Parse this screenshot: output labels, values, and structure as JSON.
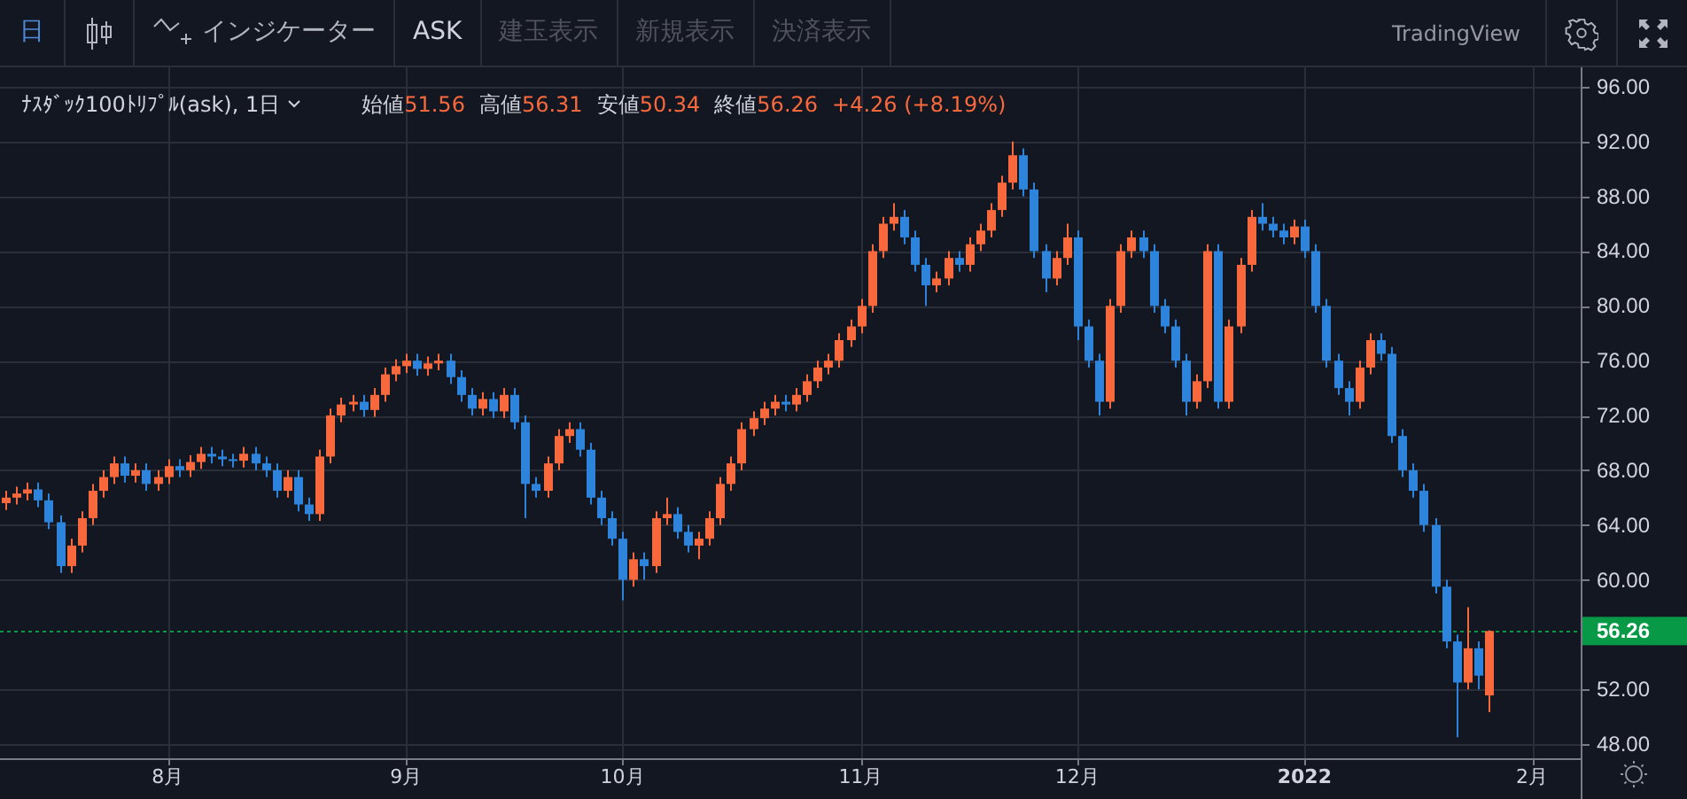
{
  "toolbar": {
    "interval": "日",
    "indicators_label": "インジケーター",
    "items": [
      {
        "label": "ASK",
        "disabled": false
      },
      {
        "label": "建玉表示",
        "disabled": true
      },
      {
        "label": "新規表示",
        "disabled": true
      },
      {
        "label": "決済表示",
        "disabled": true
      }
    ],
    "brand": "TradingView"
  },
  "legend": {
    "symbol": "ﾅｽﾀﾞｯｸ100ﾄﾘﾌﾟﾙ(ask), 1日",
    "values": [
      {
        "label": "始値",
        "value": "51.56"
      },
      {
        "label": "高値",
        "value": "56.31"
      },
      {
        "label": "安値",
        "value": "50.34"
      },
      {
        "label": "終値",
        "value": "56.26"
      }
    ],
    "change": "+4.26 (+8.19%)"
  },
  "chart": {
    "chart_data": {
      "type": "candlestick",
      "grid": true,
      "ylim": [
        46.97,
        97.42
      ],
      "yticks": [
        {
          "value": 48,
          "label": "48.00"
        },
        {
          "value": 52,
          "label": "52.00"
        },
        {
          "value": 60,
          "label": "60.00"
        },
        {
          "value": 64,
          "label": "64.00"
        },
        {
          "value": 68,
          "label": "68.00"
        },
        {
          "value": 72,
          "label": "72.00"
        },
        {
          "value": 76,
          "label": "76.00"
        },
        {
          "value": 80,
          "label": "80.00"
        },
        {
          "value": 84,
          "label": "84.00"
        },
        {
          "value": 88,
          "label": "88.00"
        },
        {
          "value": 92,
          "label": "92.00"
        },
        {
          "value": 96,
          "label": "96.00"
        }
      ],
      "ref_lines": [
        {
          "axis": "y",
          "value": 56.26,
          "label": "56.26",
          "color": "#089947"
        }
      ],
      "categories": [
        null,
        null,
        null,
        null,
        null,
        null,
        null,
        null,
        null,
        null,
        null,
        null,
        null,
        null,
        null,
        "8月",
        null,
        null,
        null,
        null,
        null,
        null,
        null,
        null,
        null,
        null,
        null,
        null,
        null,
        null,
        null,
        null,
        null,
        null,
        null,
        null,
        null,
        "9月",
        null,
        null,
        null,
        null,
        null,
        null,
        null,
        null,
        null,
        null,
        null,
        null,
        null,
        null,
        null,
        null,
        null,
        null,
        null,
        "10月",
        null,
        null,
        null,
        null,
        null,
        null,
        null,
        null,
        null,
        null,
        null,
        null,
        null,
        null,
        null,
        null,
        null,
        null,
        null,
        null,
        null,
        "11月",
        null,
        null,
        null,
        null,
        null,
        null,
        null,
        null,
        null,
        null,
        null,
        null,
        null,
        null,
        null,
        null,
        null,
        null,
        null,
        "12月",
        null,
        null,
        null,
        null,
        null,
        null,
        null,
        null,
        null,
        null,
        null,
        null,
        null,
        null,
        null,
        null,
        null,
        null,
        null,
        null,
        "2022",
        null,
        null,
        null,
        null,
        null,
        null,
        null,
        null,
        null,
        null,
        null,
        null,
        null,
        null,
        null,
        null,
        null,
        null,
        null,
        null,
        "2月"
      ],
      "ohlc": [
        [
          65.6,
          66.5,
          65.1,
          66.0
        ],
        [
          66.0,
          66.8,
          65.5,
          66.3
        ],
        [
          66.3,
          67.1,
          65.8,
          66.6
        ],
        [
          66.6,
          67.1,
          65.3,
          65.8
        ],
        [
          65.8,
          66.3,
          63.7,
          64.2
        ],
        [
          64.2,
          64.7,
          60.5,
          61.0
        ],
        [
          61.0,
          63.0,
          60.5,
          62.5
        ],
        [
          62.5,
          65.0,
          62.0,
          64.5
        ],
        [
          64.5,
          67.0,
          64.0,
          66.5
        ],
        [
          66.5,
          68.0,
          66.0,
          67.5
        ],
        [
          67.5,
          69.0,
          67.0,
          68.5
        ],
        [
          68.5,
          69.0,
          67.1,
          67.6
        ],
        [
          67.6,
          68.5,
          67.1,
          68.0
        ],
        [
          68.0,
          68.5,
          66.5,
          67.0
        ],
        [
          67.0,
          68.0,
          66.5,
          67.5
        ],
        [
          67.5,
          68.8,
          67.0,
          68.3
        ],
        [
          68.3,
          68.8,
          67.5,
          68.0
        ],
        [
          68.0,
          69.1,
          67.5,
          68.6
        ],
        [
          68.6,
          69.7,
          68.1,
          69.2
        ],
        [
          69.2,
          69.7,
          68.5,
          69.0
        ],
        [
          69.0,
          69.5,
          68.3,
          68.8
        ],
        [
          68.8,
          69.2,
          68.2,
          68.7
        ],
        [
          68.7,
          69.7,
          68.2,
          69.2
        ],
        [
          69.2,
          69.7,
          68.0,
          68.5
        ],
        [
          68.5,
          69.0,
          67.5,
          68.0
        ],
        [
          68.0,
          68.5,
          66.0,
          66.5
        ],
        [
          66.5,
          68.0,
          66.0,
          67.5
        ],
        [
          67.5,
          68.0,
          65.0,
          65.5
        ],
        [
          65.5,
          66.0,
          64.3,
          64.8
        ],
        [
          64.8,
          69.5,
          64.3,
          69.0
        ],
        [
          69.0,
          72.5,
          68.5,
          72.0
        ],
        [
          72.0,
          73.3,
          71.5,
          72.8
        ],
        [
          72.8,
          73.5,
          72.3,
          73.0
        ],
        [
          73.0,
          73.5,
          71.9,
          72.4
        ],
        [
          72.4,
          74.0,
          71.9,
          73.5
        ],
        [
          73.5,
          75.5,
          73.0,
          75.0
        ],
        [
          75.0,
          76.1,
          74.5,
          75.6
        ],
        [
          75.6,
          76.5,
          75.1,
          76.0
        ],
        [
          76.0,
          76.5,
          74.9,
          75.4
        ],
        [
          75.4,
          76.3,
          74.9,
          75.8
        ],
        [
          75.8,
          76.5,
          75.3,
          76.0
        ],
        [
          76.0,
          76.5,
          74.3,
          74.8
        ],
        [
          74.8,
          75.3,
          73.0,
          73.5
        ],
        [
          73.5,
          74.0,
          72.0,
          72.5
        ],
        [
          72.5,
          73.7,
          72.0,
          73.2
        ],
        [
          73.2,
          73.7,
          71.8,
          72.3
        ],
        [
          72.3,
          74.0,
          71.8,
          73.5
        ],
        [
          73.5,
          74.0,
          71.0,
          71.5
        ],
        [
          71.5,
          72.0,
          64.5,
          67.0
        ],
        [
          67.0,
          67.5,
          66.0,
          66.5
        ],
        [
          66.5,
          69.0,
          66.0,
          68.5
        ],
        [
          68.5,
          71.0,
          68.0,
          70.5
        ],
        [
          70.5,
          71.5,
          70.0,
          71.0
        ],
        [
          71.0,
          71.5,
          69.0,
          69.5
        ],
        [
          69.5,
          70.0,
          65.5,
          66.0
        ],
        [
          66.0,
          66.5,
          64.0,
          64.5
        ],
        [
          64.5,
          65.0,
          62.5,
          63.0
        ],
        [
          63.0,
          63.5,
          58.5,
          60.0
        ],
        [
          60.0,
          62.0,
          59.5,
          61.5
        ],
        [
          61.5,
          62.0,
          60.0,
          61.0
        ],
        [
          61.0,
          65.0,
          60.5,
          64.5
        ],
        [
          64.5,
          66.0,
          64.0,
          64.8
        ],
        [
          64.8,
          65.3,
          63.0,
          63.5
        ],
        [
          63.5,
          64.0,
          62.0,
          62.5
        ],
        [
          62.5,
          63.5,
          61.5,
          63.0
        ],
        [
          63.0,
          65.0,
          62.5,
          64.5
        ],
        [
          64.5,
          67.5,
          64.0,
          67.0
        ],
        [
          67.0,
          69.0,
          66.5,
          68.5
        ],
        [
          68.5,
          71.5,
          68.0,
          71.0
        ],
        [
          71.0,
          72.3,
          70.5,
          71.8
        ],
        [
          71.8,
          73.0,
          71.3,
          72.5
        ],
        [
          72.5,
          73.5,
          72.0,
          73.0
        ],
        [
          73.0,
          73.5,
          72.3,
          72.8
        ],
        [
          72.8,
          74.0,
          72.3,
          73.5
        ],
        [
          73.5,
          75.0,
          73.0,
          74.5
        ],
        [
          74.5,
          76.0,
          74.0,
          75.5
        ],
        [
          75.5,
          76.5,
          75.0,
          76.0
        ],
        [
          76.0,
          78.0,
          75.5,
          77.5
        ],
        [
          77.5,
          79.0,
          77.0,
          78.5
        ],
        [
          78.5,
          80.5,
          78.0,
          80.0
        ],
        [
          80.0,
          84.5,
          79.5,
          84.0
        ],
        [
          84.0,
          86.5,
          83.5,
          86.0
        ],
        [
          86.0,
          87.5,
          85.5,
          86.5
        ],
        [
          86.5,
          87.0,
          84.5,
          85.0
        ],
        [
          85.0,
          85.5,
          82.5,
          83.0
        ],
        [
          83.0,
          83.5,
          80.0,
          81.5
        ],
        [
          81.5,
          82.5,
          81.0,
          82.0
        ],
        [
          82.0,
          84.0,
          81.5,
          83.5
        ],
        [
          83.5,
          84.0,
          82.5,
          83.0
        ],
        [
          83.0,
          85.0,
          82.5,
          84.5
        ],
        [
          84.5,
          86.0,
          84.0,
          85.5
        ],
        [
          85.5,
          87.5,
          85.0,
          87.0
        ],
        [
          87.0,
          89.5,
          86.5,
          89.0
        ],
        [
          89.0,
          92.0,
          88.5,
          91.0
        ],
        [
          91.0,
          91.5,
          88.0,
          88.5
        ],
        [
          88.5,
          89.0,
          83.5,
          84.0
        ],
        [
          84.0,
          84.5,
          81.0,
          82.0
        ],
        [
          82.0,
          84.0,
          81.5,
          83.5
        ],
        [
          83.5,
          86.0,
          83.0,
          85.0
        ],
        [
          85.0,
          85.5,
          77.5,
          78.5
        ],
        [
          78.5,
          79.0,
          75.5,
          76.0
        ],
        [
          76.0,
          76.5,
          72.0,
          73.0
        ],
        [
          73.0,
          80.5,
          72.5,
          80.0
        ],
        [
          80.0,
          84.5,
          79.5,
          84.0
        ],
        [
          84.0,
          85.5,
          83.5,
          85.0
        ],
        [
          85.0,
          85.5,
          83.5,
          84.0
        ],
        [
          84.0,
          84.5,
          79.5,
          80.0
        ],
        [
          80.0,
          80.5,
          78.0,
          78.5
        ],
        [
          78.5,
          79.0,
          75.5,
          76.0
        ],
        [
          76.0,
          76.5,
          72.0,
          73.0
        ],
        [
          73.0,
          75.0,
          72.5,
          74.5
        ],
        [
          74.5,
          84.5,
          74.0,
          84.0
        ],
        [
          84.0,
          84.5,
          72.5,
          73.0
        ],
        [
          73.0,
          79.0,
          72.5,
          78.5
        ],
        [
          78.5,
          83.5,
          78.0,
          83.0
        ],
        [
          83.0,
          87.0,
          82.5,
          86.5
        ],
        [
          86.5,
          87.5,
          85.5,
          86.0
        ],
        [
          86.0,
          86.5,
          85.0,
          85.5
        ],
        [
          85.5,
          86.0,
          84.5,
          85.0
        ],
        [
          85.0,
          86.3,
          84.5,
          85.8
        ],
        [
          85.8,
          86.3,
          83.5,
          84.0
        ],
        [
          84.0,
          84.5,
          79.5,
          80.0
        ],
        [
          80.0,
          80.5,
          75.5,
          76.0
        ],
        [
          76.0,
          76.5,
          73.5,
          74.0
        ],
        [
          74.0,
          74.5,
          72.0,
          73.0
        ],
        [
          73.0,
          76.0,
          72.5,
          75.5
        ],
        [
          75.5,
          78.0,
          75.0,
          77.5
        ],
        [
          77.5,
          78.0,
          76.0,
          76.5
        ],
        [
          76.5,
          77.0,
          70.0,
          70.5
        ],
        [
          70.5,
          71.0,
          67.5,
          68.0
        ],
        [
          68.0,
          68.5,
          66.0,
          66.5
        ],
        [
          66.5,
          67.0,
          63.5,
          64.0
        ],
        [
          64.0,
          64.5,
          59.0,
          59.5
        ],
        [
          59.5,
          60.0,
          55.0,
          55.5
        ],
        [
          55.5,
          56.0,
          48.5,
          52.5
        ],
        [
          52.5,
          58.0,
          52.0,
          55.0
        ],
        [
          55.0,
          55.5,
          52.0,
          53.0
        ],
        [
          51.56,
          56.31,
          50.34,
          56.26
        ],
        null,
        null,
        null,
        null
      ]
    }
  }
}
